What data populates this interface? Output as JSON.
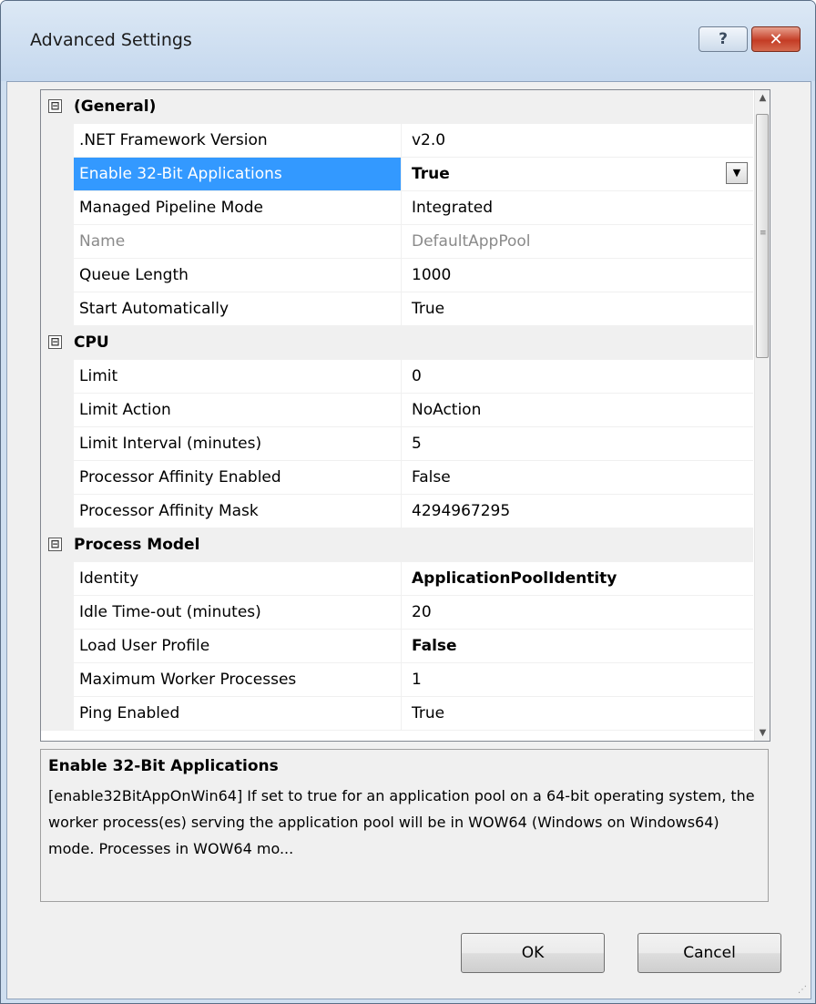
{
  "window": {
    "title": "Advanced Settings",
    "help_glyph": "?",
    "close_glyph": "✕"
  },
  "grid": {
    "categories": [
      {
        "label": "(General)",
        "toggle": "⊟",
        "rows": [
          {
            "name": ".NET Framework Version",
            "value": "v2.0"
          },
          {
            "name": "Enable 32-Bit Applications",
            "value": "True",
            "selected": true,
            "bold": true
          },
          {
            "name": "Managed Pipeline Mode",
            "value": "Integrated"
          },
          {
            "name": "Name",
            "value": "DefaultAppPool",
            "readonly": true
          },
          {
            "name": "Queue Length",
            "value": "1000"
          },
          {
            "name": "Start Automatically",
            "value": "True"
          }
        ]
      },
      {
        "label": "CPU",
        "toggle": "⊟",
        "rows": [
          {
            "name": "Limit",
            "value": "0"
          },
          {
            "name": "Limit Action",
            "value": "NoAction"
          },
          {
            "name": "Limit Interval (minutes)",
            "value": "5"
          },
          {
            "name": "Processor Affinity Enabled",
            "value": "False"
          },
          {
            "name": "Processor Affinity Mask",
            "value": "4294967295"
          }
        ]
      },
      {
        "label": "Process Model",
        "toggle": "⊟",
        "rows": [
          {
            "name": "Identity",
            "value": "ApplicationPoolIdentity",
            "bold": true
          },
          {
            "name": "Idle Time-out (minutes)",
            "value": "20"
          },
          {
            "name": "Load User Profile",
            "value": "False",
            "bold": true
          },
          {
            "name": "Maximum Worker Processes",
            "value": "1"
          },
          {
            "name": "Ping Enabled",
            "value": "True"
          }
        ]
      }
    ]
  },
  "description": {
    "title": "Enable 32-Bit Applications",
    "text": "[enable32BitAppOnWin64] If set to true for an application pool on a 64-bit operating system, the worker process(es) serving the application pool will be in WOW64 (Windows on Windows64) mode. Processes in WOW64 mo..."
  },
  "buttons": {
    "ok": "OK",
    "cancel": "Cancel"
  },
  "colors": {
    "selection": "#3399ff",
    "category_bg": "#f0f0f0"
  }
}
